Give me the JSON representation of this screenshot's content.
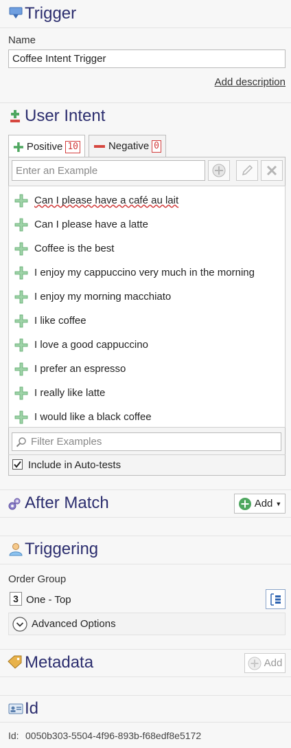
{
  "trigger": {
    "title": "Trigger",
    "name_label": "Name",
    "name_value": "Coffee Intent Trigger",
    "add_description": "Add description"
  },
  "user_intent": {
    "title": "User Intent",
    "tabs": [
      {
        "label": "Positive",
        "count": "10"
      },
      {
        "label": "Negative",
        "count": "0"
      }
    ],
    "example_placeholder": "Enter an Example",
    "examples": [
      "Can I please have a café au lait",
      "Can I please have a latte",
      "Coffee is the best",
      "I enjoy my cappuccino very much in the morning",
      "I enjoy my morning macchiato",
      "I like coffee",
      "I love a good cappuccino",
      "I prefer an espresso",
      "I really like latte",
      "I would like a black coffee"
    ],
    "filter_placeholder": "Filter Examples",
    "include_label": "Include in Auto-tests",
    "include_checked": true
  },
  "after_match": {
    "title": "After Match",
    "add_label": "Add"
  },
  "triggering": {
    "title": "Triggering",
    "order_group_label": "Order Group",
    "order_badge": "3",
    "order_value": "One - Top",
    "advanced_label": "Advanced Options"
  },
  "metadata": {
    "title": "Metadata",
    "add_label": "Add"
  },
  "id_section": {
    "title": "Id",
    "id_label": "Id:",
    "id_value": "0050b303-5504-4f96-893b-f68edf8e5172"
  }
}
